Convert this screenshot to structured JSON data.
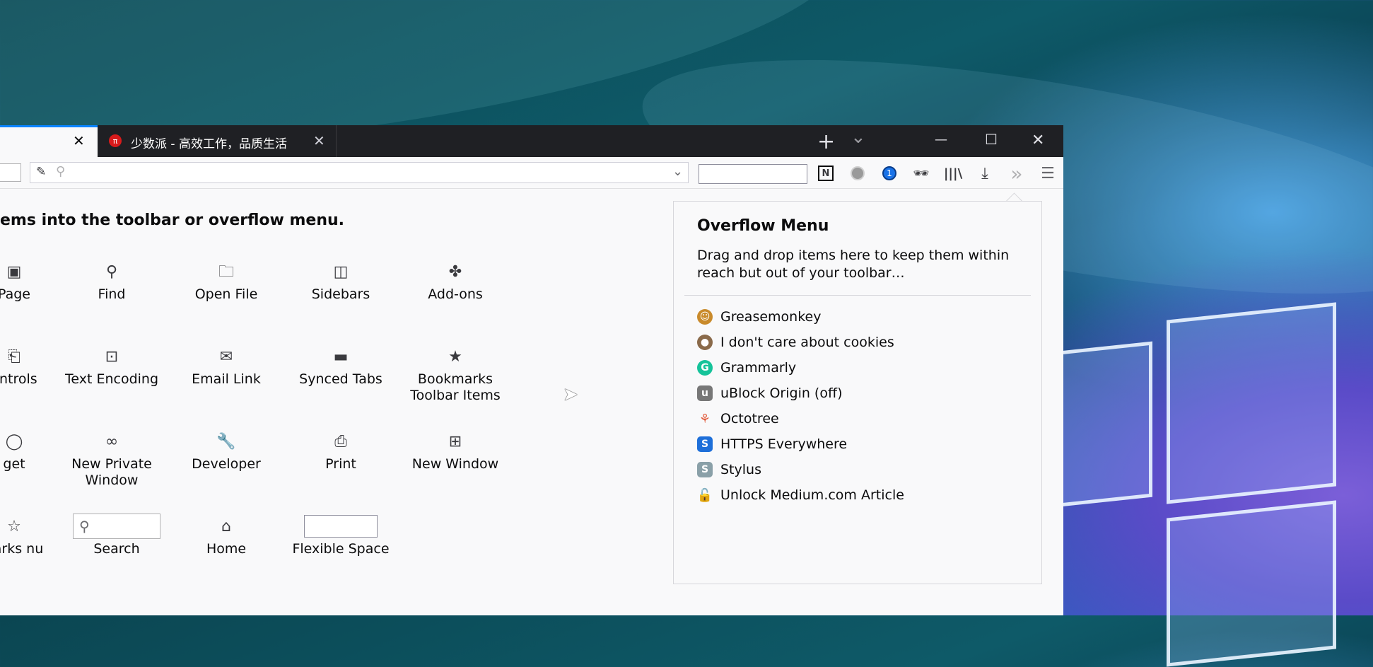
{
  "tabs": [
    {
      "label": "",
      "close": "✕"
    },
    {
      "label": "少数派 - 高效工作，品质生活",
      "close": "✕"
    }
  ],
  "toolbar": {
    "new_tab": "+",
    "tab_list": "⌄",
    "minimize": "—",
    "maximize": "☐",
    "close": "✕",
    "overflow_chevron": "»",
    "menu": "☰"
  },
  "customize": {
    "heading": "ems into the toolbar or overflow menu.",
    "items": [
      {
        "label": "Page",
        "icon": "page-icon"
      },
      {
        "label": "Find",
        "icon": "search-icon"
      },
      {
        "label": "Open File",
        "icon": "open-file-icon"
      },
      {
        "label": "Sidebars",
        "icon": "sidebar-icon"
      },
      {
        "label": "Add-ons",
        "icon": "puzzle-icon"
      },
      {
        "label": "ontrols",
        "icon": "controls-icon"
      },
      {
        "label": "Text Encoding",
        "icon": "text-encoding-icon"
      },
      {
        "label": "Email Link",
        "icon": "email-icon"
      },
      {
        "label": "Synced Tabs",
        "icon": "synced-tabs-icon"
      },
      {
        "label": "Bookmarks Toolbar Items",
        "icon": "bookmark-star-icon"
      },
      {
        "label": "get",
        "icon": "widget-icon"
      },
      {
        "label": "New Private Window",
        "icon": "private-mask-icon"
      },
      {
        "label": "Developer",
        "icon": "wrench-icon"
      },
      {
        "label": "Print",
        "icon": "printer-icon"
      },
      {
        "label": "New Window",
        "icon": "new-window-icon"
      },
      {
        "label": "narks nu",
        "icon": "bookmarks-menu-icon"
      },
      {
        "label": "Search",
        "icon": "search-field-icon"
      },
      {
        "label": "Home",
        "icon": "home-icon"
      },
      {
        "label": "Flexible Space",
        "icon": "flexible-space-icon"
      }
    ]
  },
  "overflow_menu": {
    "title": "Overflow Menu",
    "description": "Drag and drop items here to keep them within reach but out of your toolbar…",
    "extensions": [
      {
        "label": "Greasemonkey",
        "icon": "greasemonkey-icon",
        "color": "#c98a2b"
      },
      {
        "label": "I don't care about cookies",
        "icon": "cookie-icon",
        "color": "#8a6a4a"
      },
      {
        "label": "Grammarly",
        "icon": "grammarly-icon",
        "color": "#15c39a"
      },
      {
        "label": "uBlock Origin (off)",
        "icon": "ublock-icon",
        "color": "#777777"
      },
      {
        "label": "Octotree",
        "icon": "octotree-icon",
        "color": "#e25a3a"
      },
      {
        "label": "HTTPS Everywhere",
        "icon": "https-everywhere-icon",
        "color": "#1e6fd9"
      },
      {
        "label": "Stylus",
        "icon": "stylus-icon",
        "color": "#8aa0a8"
      },
      {
        "label": "Unlock Medium.com Article",
        "icon": "lock-icon",
        "color": "#222222"
      }
    ]
  },
  "colors": {
    "accent": "#0a84ff",
    "tabbar": "#1f2024"
  }
}
